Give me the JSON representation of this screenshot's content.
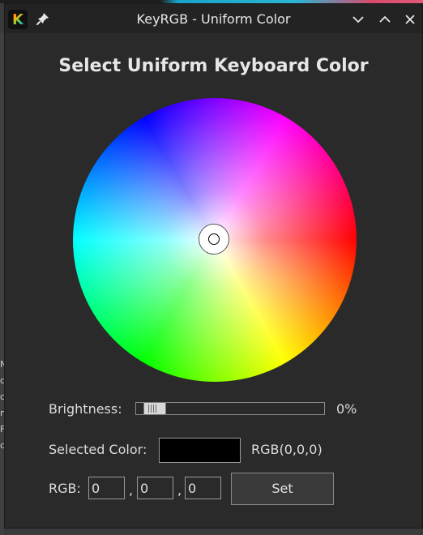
{
  "window": {
    "title": "KeyRGB - Uniform Color",
    "app_icon_letter": "K"
  },
  "main": {
    "heading": "Select Uniform Keyboard Color",
    "brightness_label": "Brightness:",
    "brightness_value": "0%",
    "brightness_level": 0.05,
    "selected_color_label": "Selected Color:",
    "selected_color_value": "RGB(0,0,0)",
    "selected_color_hex": "#000000",
    "rgb_label": "RGB:",
    "rgb_r": "0",
    "rgb_g": "0",
    "rgb_b": "0",
    "comma": ",",
    "set_label": "Set"
  },
  "desktop": {
    "left_edge_letters": [
      "N",
      "c",
      "",
      "c",
      "n",
      "F",
      "c"
    ]
  },
  "icons": {
    "pin": "pin-icon",
    "minimize": "chevron-down-icon",
    "maximize": "chevron-up-icon",
    "close": "close-icon"
  }
}
